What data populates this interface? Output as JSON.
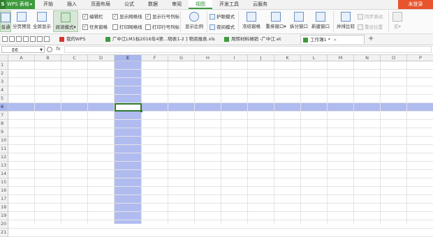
{
  "app": {
    "name": "WPS 表格",
    "logo_letter": "S"
  },
  "menu_tabs": [
    "开始",
    "插入",
    "页面布局",
    "公式",
    "数据",
    "审阅",
    "视图",
    "开发工具",
    "云服务"
  ],
  "active_menu_tab": "视图",
  "login_label": "未登录",
  "ribbon": {
    "normal_view": "普通",
    "page_break_preview": "分页预览",
    "full_screen": "全屏显示",
    "reading_mode": "阅读模式",
    "edit_bar": "编辑栏",
    "task_pane": "任务窗格",
    "show_gridlines": "显示网格线",
    "print_gridlines": "打印网格线",
    "show_row_col_headers": "显示行号列标",
    "print_row_col_headers": "打印行号列标",
    "zoom": "显示比例",
    "eye_protection": "护眼模式",
    "night_mode": "夜间模式",
    "freeze_panes": "冻结窗格",
    "arrange_windows": "重排窗口",
    "split_window": "拆分窗口",
    "new_window": "新建窗口",
    "side_by_side": "并排比较",
    "sync_scroll": "同步滚动",
    "reset_position": "重设位置",
    "macro": "宏"
  },
  "doc_tabs": [
    {
      "label": "我的WPS",
      "active": false
    },
    {
      "label": "广中江LM1标2016年4第...物表1-2 ] 物资报表.xls",
      "active": false
    },
    {
      "label": "周转材料摊销 -广中江.et",
      "active": false
    },
    {
      "label": "工作簿1 *",
      "active": true
    }
  ],
  "formula_bar": {
    "cell_ref": "E6",
    "fx": "fx",
    "value": ""
  },
  "sheet": {
    "columns": [
      "A",
      "B",
      "C",
      "D",
      "E",
      "F",
      "G",
      "H",
      "I",
      "J",
      "K",
      "L",
      "M",
      "N",
      "O",
      "P"
    ],
    "rows": [
      "1",
      "2",
      "3",
      "4",
      "5",
      "6",
      "7",
      "8",
      "9",
      "10",
      "11",
      "12",
      "13",
      "14",
      "15",
      "16",
      "17",
      "18",
      "19",
      "20",
      "21"
    ],
    "selected_column": "E",
    "selected_row": "6"
  },
  "colors": {
    "accent": "#3d9a3d",
    "selection": "#b0bbf0",
    "login_bg": "#e8542b"
  }
}
